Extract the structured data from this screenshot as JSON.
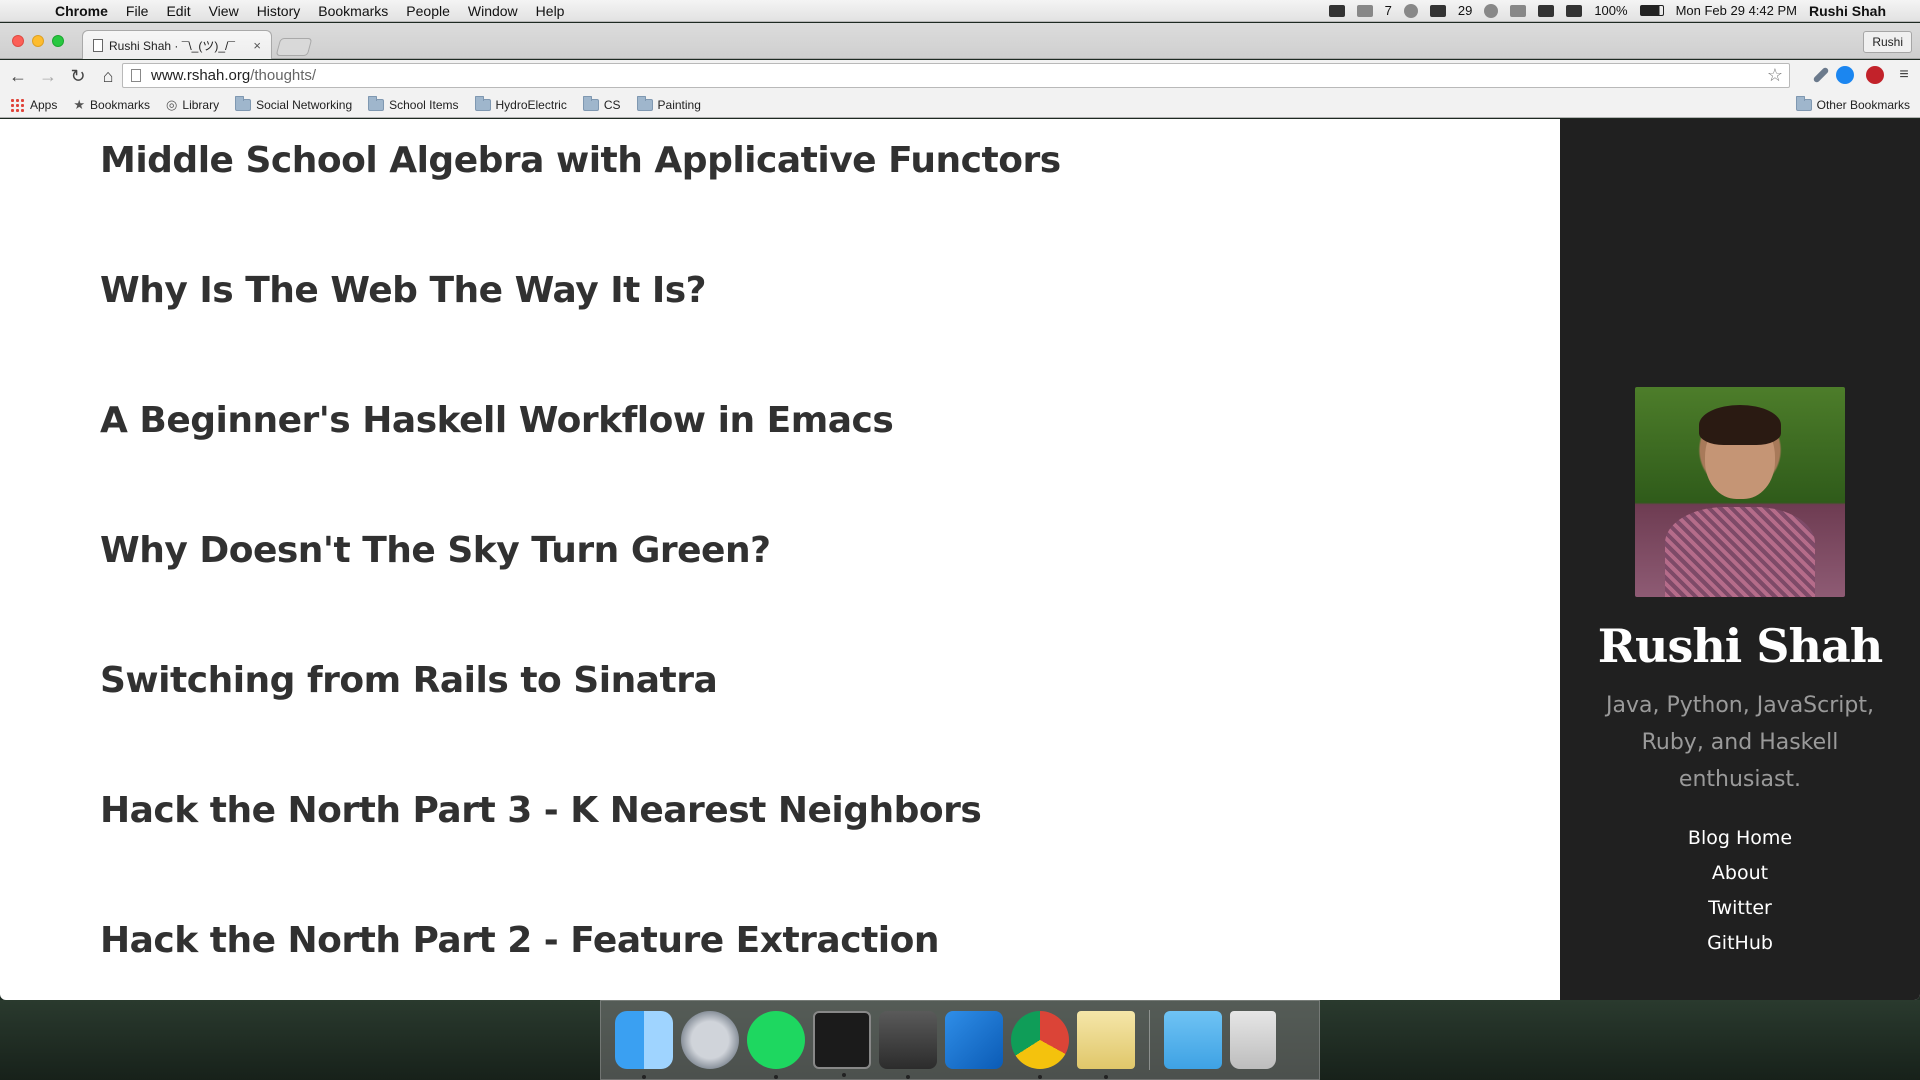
{
  "menubar": {
    "app": "Chrome",
    "items": [
      "File",
      "Edit",
      "View",
      "History",
      "Bookmarks",
      "People",
      "Window",
      "Help"
    ],
    "status": {
      "notification_count": "7",
      "calendar_day": "29",
      "battery": "100%",
      "datetime": "Mon Feb 29  4:42 PM",
      "user": "Rushi Shah"
    }
  },
  "browser": {
    "tab_title": "Rushi Shah · ¯\\_(ツ)_/¯",
    "tab_close": "×",
    "profile": "Rushi",
    "url_domain": "www.rshah.org",
    "url_path": "/thoughts/",
    "bookmarks": [
      {
        "label": "Apps",
        "icon": "apps-grid-icon"
      },
      {
        "label": "Bookmarks",
        "icon": "star-icon"
      },
      {
        "label": "Library",
        "icon": "library-icon"
      },
      {
        "label": "Social Networking",
        "icon": "folder-icon"
      },
      {
        "label": "School Items",
        "icon": "folder-icon"
      },
      {
        "label": "HydroElectric",
        "icon": "folder-icon"
      },
      {
        "label": "CS",
        "icon": "folder-icon"
      },
      {
        "label": "Painting",
        "icon": "folder-icon"
      }
    ],
    "other_bookmarks": "Other Bookmarks"
  },
  "page": {
    "posts": [
      "Middle School Algebra with Applicative Functors",
      "Why Is The Web The Way It Is?",
      "A Beginner's Haskell Workflow in Emacs",
      "Why Doesn't The Sky Turn Green?",
      "Switching from Rails to Sinatra",
      "Hack the North Part 3 - K Nearest Neighbors",
      "Hack the North Part 2 - Feature Extraction"
    ],
    "sidebar": {
      "name": "Rushi Shah",
      "tagline": "Java, Python, JavaScript, Ruby, and Haskell enthusiast.",
      "nav": [
        "Blog Home",
        "About",
        "Twitter",
        "GitHub"
      ]
    }
  },
  "dock": [
    "finder",
    "launchpad",
    "spotify",
    "terminal",
    "sublime-text",
    "word",
    "chrome",
    "preview",
    "downloads",
    "trash"
  ]
}
